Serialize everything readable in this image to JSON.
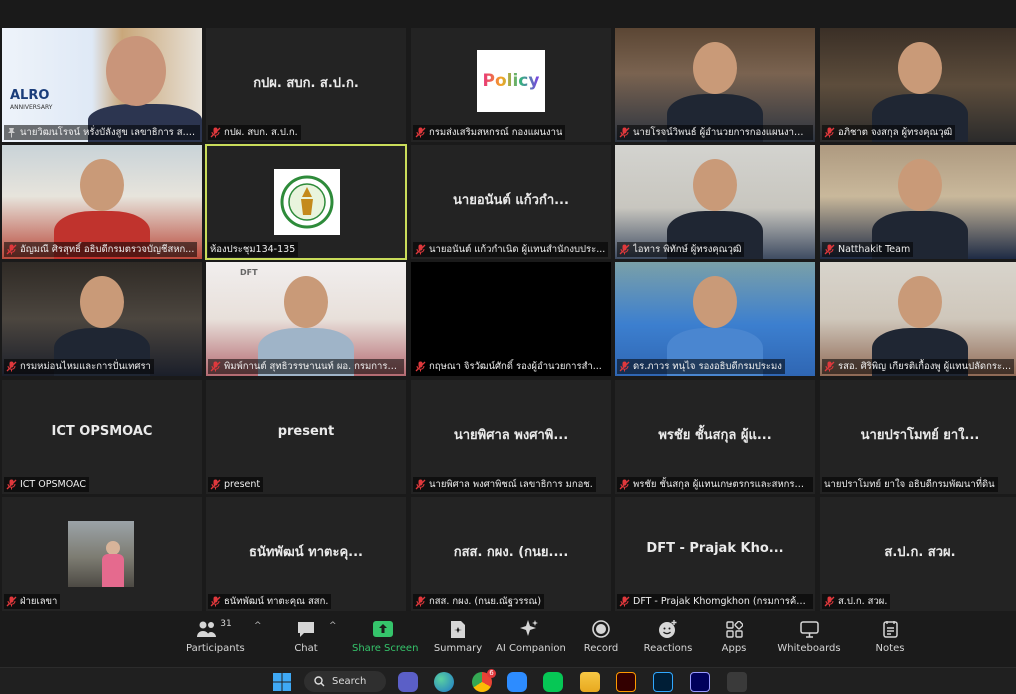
{
  "colors": {
    "active_border": "#c9dc5a",
    "share_green": "#35c46b",
    "muted_red": "#e0383c",
    "tile_bg": "#232323"
  },
  "tiles": [
    {
      "caption": "นายวิฒนโรจน์ หรั่งบัลังสูข เลขาธิการ ส.ป.ก.",
      "video": "v-alro",
      "icon": "pin",
      "logo": "ALRO",
      "logo_sub": "ANNIVERSARY"
    },
    {
      "caption": "กปผ. สบก. ส.ป.ก.",
      "center": "กปผ. สบก. ส.ป.ก."
    },
    {
      "caption": "กรมส่งเสริมสหกรณ์ กองแผนงาน",
      "center_logo": "Policy"
    },
    {
      "caption": "นายโรจน์วิพนธ์ ผู้อำนวยการกองแผนงาน ...",
      "video": "v-office1"
    },
    {
      "caption": "อภิชาต จงสกุล ผู้ทรงคุณวุฒิ",
      "video": "v-office2"
    },
    {
      "caption": "อัญมณี ศิรสุทธิ์ อธิบดีกรมตรวจบัญชีสหก...",
      "video": "v-red"
    },
    {
      "caption": "ห้องประชุม134-135",
      "seal": true,
      "active": true,
      "icon": "none"
    },
    {
      "caption": "นายอนันต์ แก้วกำเนิด ผู้แทนสำนักงบประ...",
      "center": "นายอนันต์ แก้วกำ..."
    },
    {
      "caption": "ไอทาร พิทักษ์ ผู้ทรงคุณวุฒิ",
      "video": "v-gray"
    },
    {
      "caption": "Natthakit Team",
      "video": "v-room"
    },
    {
      "caption": "กรมหม่อนไหมและการปั่นเทศรา",
      "video": "v-dark"
    },
    {
      "caption": "พิมพ์กานต์ สุทธิวรรษานนท์ ผอ. กรมการค้า...",
      "video": "v-pink",
      "brand": "DFT"
    },
    {
      "caption": "กฤษณา จิรวัฒน์ศักดิ์ รองผู้อำนวยการสำ...",
      "video": "v-black"
    },
    {
      "caption": "ดร.ภาวร ทนุไจ รองอธิบดีกรมประมง",
      "video": "v-blue"
    },
    {
      "caption": "รสอ. ศิริพิญ เกียรติเกื้องพู ผู้แทนปลัดกระ...",
      "video": "v-chair"
    },
    {
      "caption": "ICT OPSMOAC",
      "center": "ICT OPSMOAC"
    },
    {
      "caption": "present",
      "center": "present"
    },
    {
      "caption": "นายพิศาล พงศาพิชณ์ เลขาธิการ มกอช.",
      "center": "นายพิศาล พงศาพิ..."
    },
    {
      "caption": "พรชัย ชั้นสกุล ผู้แทนเกษตรกรและสหกรณ์...",
      "center": "พรชัย ชั้นสกุล ผู้แ..."
    },
    {
      "caption": "นายปราโมทย์ ยาใจ อธิบดีกรมพัฒนาที่ดิน",
      "center": "นายปราโมทย์ ยาใ...",
      "icon": "none"
    },
    {
      "caption": "ฝ่ายเลขา",
      "thumb": true
    },
    {
      "caption": "ธนัทพัฒน์ ทาตะคุณ สสก.",
      "center": "ธนัทพัฒน์ ทาตะคุ..."
    },
    {
      "caption": "กสส. กผง. (กนย.ณัฐวรรณ)",
      "center": "กสส. กผง. (กนย...."
    },
    {
      "caption": "DFT - Prajak Khomgkhon (กรมการค้า...",
      "center": "DFT - Prajak Kho..."
    },
    {
      "caption": "ส.ป.ก. สวผ.",
      "center": "ส.ป.ก. สวผ."
    }
  ],
  "toolbar": {
    "participants_label": "Participants",
    "participants_count": "31",
    "chat_label": "Chat",
    "share_label": "Share Screen",
    "summary_label": "Summary",
    "companion_label": "AI Companion",
    "record_label": "Record",
    "reactions_label": "Reactions",
    "apps_label": "Apps",
    "whiteboards_label": "Whiteboards",
    "notes_label": "Notes"
  },
  "taskbar": {
    "search_label": "Search",
    "chrome_badge": "6",
    "apps": [
      "windows-start",
      "search",
      "meeting",
      "edge",
      "chrome",
      "zoom",
      "line",
      "files",
      "illustrator",
      "photoshop",
      "premiere",
      "calculator"
    ]
  }
}
